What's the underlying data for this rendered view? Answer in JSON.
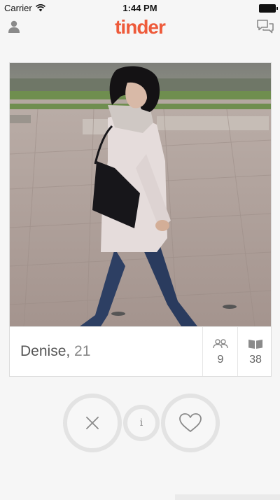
{
  "status": {
    "carrier": "Carrier",
    "time": "1:44 PM"
  },
  "app": {
    "logo": "tinder",
    "brand_color": "#ee5a3a"
  },
  "nav": {
    "left_icon": "profile-icon",
    "right_icon": "messages-icon"
  },
  "profile": {
    "name": "Denise,",
    "age": "21",
    "mutual_friends": "9",
    "shared_interests": "38"
  },
  "actions": {
    "dislike_icon": "close-icon",
    "info_label": "i",
    "like_icon": "heart-icon"
  }
}
